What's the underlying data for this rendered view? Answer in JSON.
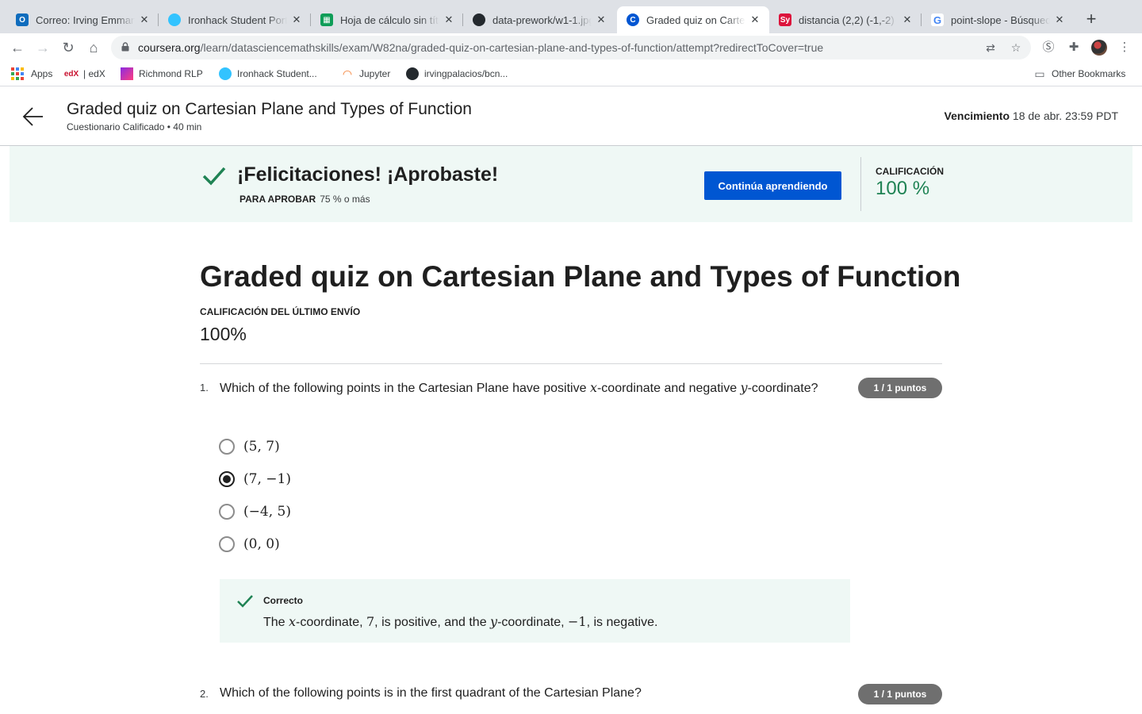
{
  "browser": {
    "tabs": [
      {
        "title": "Correo: Irving Emmanuel",
        "icon": "outlook-icon",
        "color": "#0f6cbd"
      },
      {
        "title": "Ironhack Student Portal",
        "icon": "ironhack-icon",
        "color": "#32c3ff"
      },
      {
        "title": "Hoja de cálculo sin título",
        "icon": "sheets-icon",
        "color": "#0f9d58"
      },
      {
        "title": "data-prework/w1-1.jpg",
        "icon": "github-icon",
        "color": "#24292e"
      },
      {
        "title": "Graded quiz on Cartesian",
        "icon": "coursera-icon",
        "color": "#0056d2",
        "active": true
      },
      {
        "title": "distancia (2,2) (-1,-2)",
        "icon": "symbolab-icon",
        "color": "#dc143c"
      },
      {
        "title": "point-slope - Búsqueda",
        "icon": "google-icon",
        "color": "#4285f4"
      }
    ],
    "new_tab": "+",
    "url_host": "coursera.org",
    "url_path": "/learn/datasciencemathskills/exam/W82na/graded-quiz-on-cartesian-plane-and-types-of-function/attempt?redirectToCover=true",
    "bookmarks": [
      {
        "label": "Apps",
        "icon": "apps-grid-icon"
      },
      {
        "label": "| edX",
        "icon": "edx-icon"
      },
      {
        "label": "Richmond RLP",
        "icon": "richmond-icon"
      },
      {
        "label": "Ironhack Student...",
        "icon": "ironhack-icon"
      },
      {
        "label": "Jupyter",
        "icon": "jupyter-icon"
      },
      {
        "label": "irvingpalacios/bcn...",
        "icon": "github-icon"
      }
    ],
    "other_bookmarks": "Other Bookmarks"
  },
  "header": {
    "title": "Graded quiz on Cartesian Plane and Types of Function",
    "subtitle": "Cuestionario Calificado • 40 min",
    "due_label": "Vencimiento",
    "due_value": "18 de abr. 23:59 PDT"
  },
  "banner": {
    "congrats": "¡Felicitaciones! ¡Aprobaste!",
    "pass_label": "PARA APROBAR",
    "pass_value": "75 % o más",
    "continue_button": "Continúa aprendiendo",
    "grade_label": "CALIFICACIÓN",
    "grade_value": "100 %",
    "accent_color": "#1f8354",
    "button_color": "#0056d2"
  },
  "main": {
    "title": "Graded quiz on Cartesian Plane and Types of Function",
    "last_submission_label": "CALIFICACIÓN DEL ÚLTIMO ENVÍO",
    "last_submission_value": "100%",
    "questions": [
      {
        "number": "1.",
        "text_a": "Which of the following points in the Cartesian Plane have positive ",
        "var_a": "x",
        "text_b": "-coordinate and negative ",
        "var_b": "y",
        "text_c": "-coordinate?",
        "points": "1 / 1 puntos",
        "options": [
          {
            "label": "(5, 7)",
            "selected": false
          },
          {
            "label": "(7, −1)",
            "selected": true
          },
          {
            "label": "(−4, 5)",
            "selected": false
          },
          {
            "label": "(0, 0)",
            "selected": false
          }
        ],
        "feedback": {
          "status": "Correcto",
          "t1": "The ",
          "v1": "x",
          "t2": "-coordinate, ",
          "n1": "7",
          "t3": ", is positive, and the ",
          "v2": "y",
          "t4": "-coordinate, ",
          "n2": "−1",
          "t5": ", is negative."
        }
      },
      {
        "number": "2.",
        "text": "Which of the following points is in the first quadrant of the Cartesian Plane?",
        "points": "1 / 1 puntos"
      }
    ]
  }
}
